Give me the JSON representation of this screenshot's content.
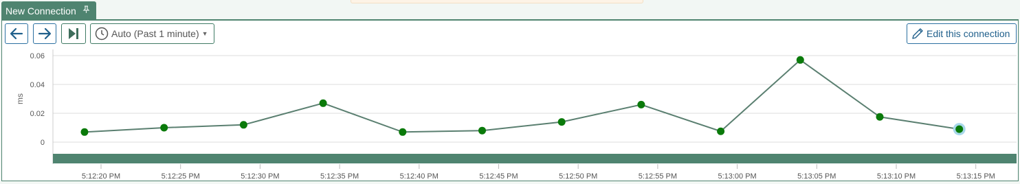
{
  "tab": {
    "title": "New Connection",
    "pin_icon": "pin-icon"
  },
  "toolbar": {
    "back_icon": "arrow-left-icon",
    "forward_icon": "arrow-right-icon",
    "end_icon": "skip-to-end-icon",
    "time_range_label": "Auto (Past 1 minute)",
    "time_range_icon": "clock-icon",
    "edit_label": "Edit this connection",
    "edit_icon": "pencil-icon"
  },
  "colors": {
    "accent": "#4f8470",
    "point": "#0a7a0a",
    "line": "#5a7f70",
    "link": "#1f5f8b"
  },
  "chart_data": {
    "type": "line",
    "ylabel": "ms",
    "xlabel": "",
    "ylim": [
      0,
      0.06
    ],
    "yticks": [
      "0",
      "0.02",
      "0.04",
      "0.06"
    ],
    "x": [
      "5:12:19 PM",
      "5:12:24 PM",
      "5:12:29 PM",
      "5:12:34 PM",
      "5:12:39 PM",
      "5:12:44 PM",
      "5:12:49 PM",
      "5:12:54 PM",
      "5:12:59 PM",
      "5:13:04 PM",
      "5:13:09 PM",
      "5:13:14 PM"
    ],
    "xticks": [
      "5:12:20 PM",
      "5:12:25 PM",
      "5:12:30 PM",
      "5:12:35 PM",
      "5:12:40 PM",
      "5:12:45 PM",
      "5:12:50 PM",
      "5:12:55 PM",
      "5:13:00 PM",
      "5:13:05 PM",
      "5:13:10 PM",
      "5:13:15 PM"
    ],
    "series": [
      {
        "values": [
          0.007,
          0.01,
          0.012,
          0.027,
          0.007,
          0.008,
          0.014,
          0.026,
          0.0075,
          0.057,
          0.0175,
          0.009
        ]
      }
    ],
    "highlighted_point": 11,
    "grid": true
  }
}
